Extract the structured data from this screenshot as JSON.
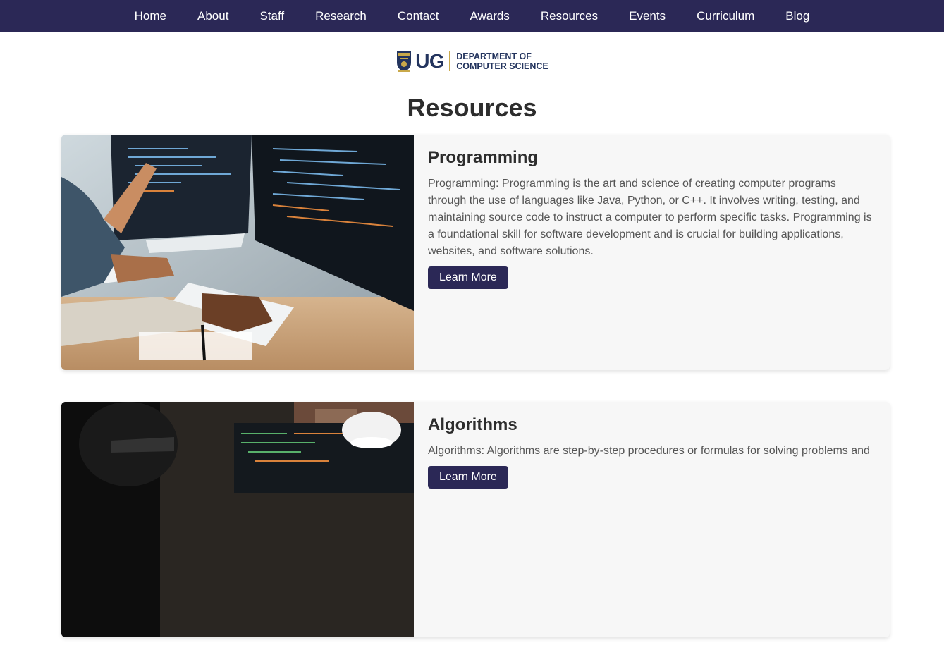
{
  "nav": {
    "items": [
      "Home",
      "About",
      "Staff",
      "Research",
      "Contact",
      "Awards",
      "Resources",
      "Events",
      "Curriculum",
      "Blog"
    ]
  },
  "logo": {
    "abbr": "UG",
    "line1": "DEPARTMENT OF",
    "line2": "COMPUTER SCIENCE"
  },
  "page_title": "Resources",
  "cards": [
    {
      "title": "Programming",
      "text": "Programming: Programming is the art and science of creating computer programs through the use of languages like Java, Python, or C++. It involves writing, testing, and maintaining source code to instruct a computer to perform specific tasks. Programming is a foundational skill for software development and is crucial for building applications, websites, and software solutions.",
      "button": "Learn More"
    },
    {
      "title": "Algorithms",
      "text": "Algorithms: Algorithms are step-by-step procedures or formulas for solving problems and",
      "button": "Learn More"
    }
  ],
  "colors": {
    "nav_bg": "#2b2856",
    "button_bg": "#2b2856",
    "logo_blue": "#23345e"
  }
}
